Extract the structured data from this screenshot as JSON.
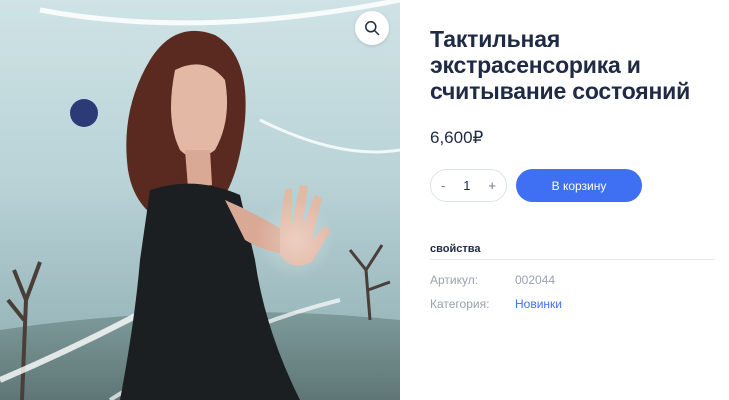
{
  "product": {
    "title": "Тактильная экстрасенсорика и считывание состояний",
    "price": "6,600₽",
    "image_alt_icon": "zoom-icon"
  },
  "quantity": {
    "minus": "-",
    "value": "1",
    "plus": "+"
  },
  "cart_button": "В корзину",
  "properties": {
    "heading": "свойства",
    "rows": [
      {
        "label": "Артикул:",
        "value": "002044"
      },
      {
        "label": "Категория:",
        "value": "Новинки"
      }
    ]
  },
  "colors": {
    "accent": "#3f6ff2",
    "text": "#1f2a44",
    "muted": "#9aa1ad"
  }
}
